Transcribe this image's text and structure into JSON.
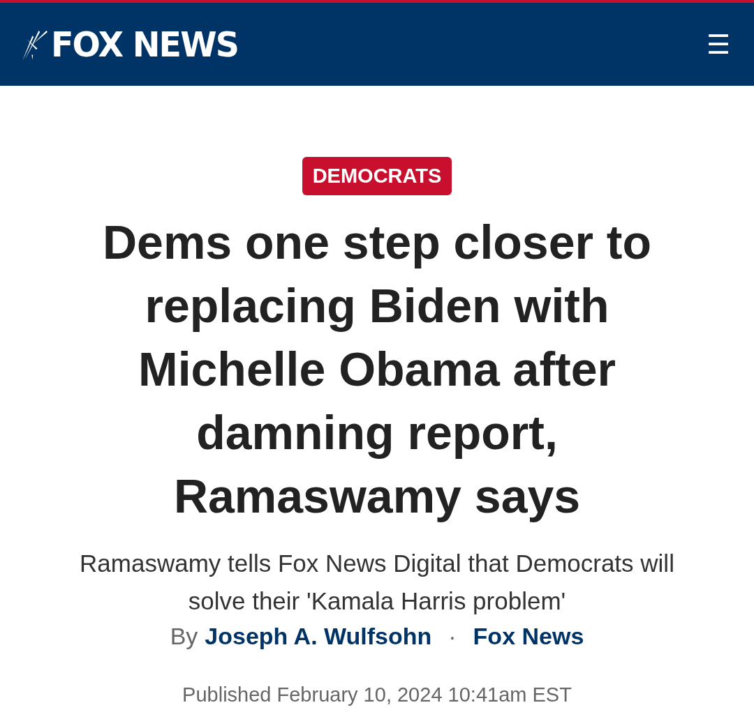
{
  "header": {
    "logo": "FOX NEWS",
    "menu_icon": "☰"
  },
  "article": {
    "category": "DEMOCRATS",
    "headline": "Dems one step closer to replacing Biden with Michelle Obama after damning report, Ramaswamy says",
    "subheadline": "Ramaswamy tells Fox News Digital that Democrats will solve their 'Kamala Harris problem'",
    "byline": {
      "prefix": "By",
      "author": "Joseph A. Wulfsohn",
      "separator": "·",
      "source": "Fox News"
    },
    "published": "Published February 10, 2024 10:41am EST"
  }
}
